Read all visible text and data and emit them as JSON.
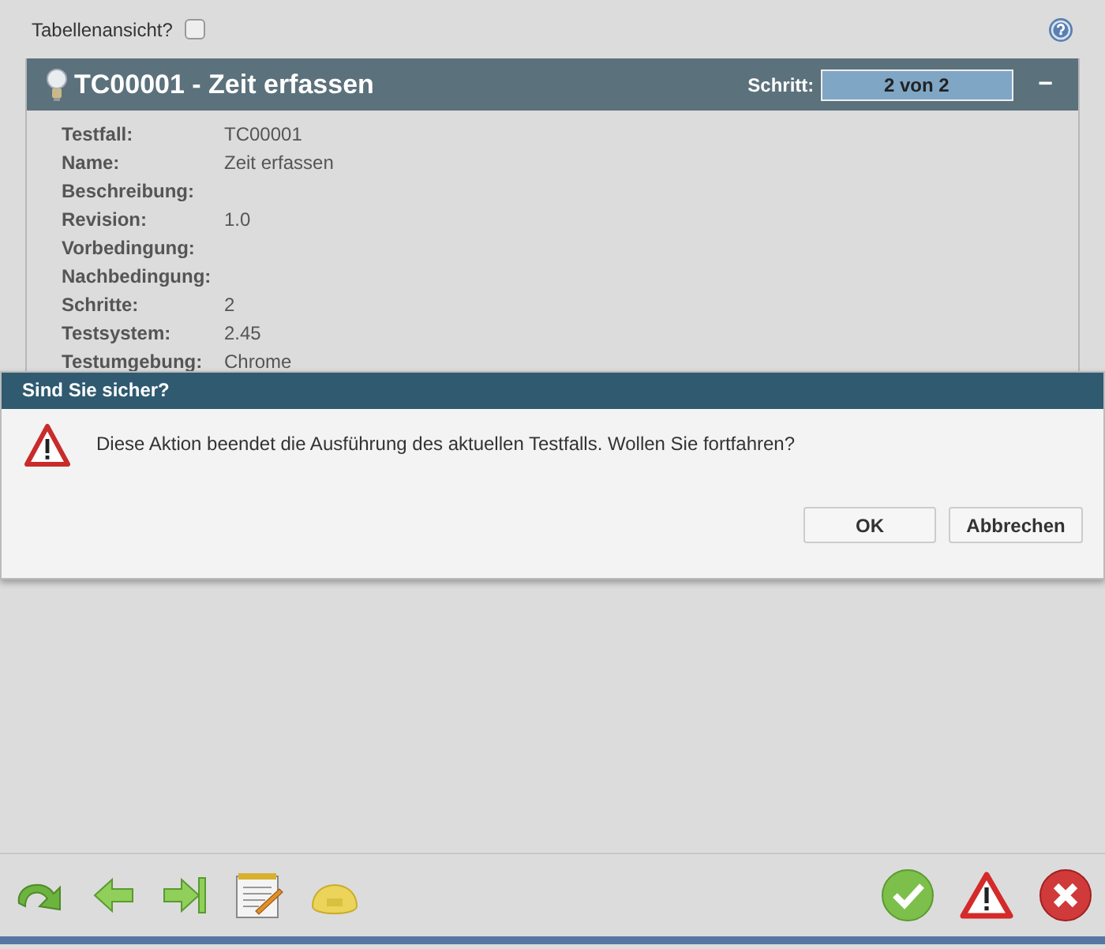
{
  "top_bar": {
    "table_view": {
      "label": "Tabellenansicht?",
      "checked": false
    }
  },
  "panel": {
    "title": "TC00001 - Zeit erfassen",
    "step_label": "Schritt:",
    "step_value": "2 von 2",
    "collapse": "−",
    "fields": [
      {
        "label": "Testfall:",
        "value": "TC00001"
      },
      {
        "label": "Name:",
        "value": "Zeit erfassen"
      },
      {
        "label": "Beschreibung:"
      },
      {
        "label": "Revision:",
        "value": "1.0"
      },
      {
        "label": "Vorbedingung:"
      },
      {
        "label": "Nachbedingung:"
      },
      {
        "label": "Schritte:",
        "value": "2"
      },
      {
        "label": "Testsystem:",
        "value": "2.45"
      },
      {
        "label": "Testumgebung:",
        "value": "Chrome"
      }
    ]
  },
  "dialog": {
    "title": "Sind Sie sicher?",
    "message": "Diese Aktion beendet die Ausführung des aktuellen Testfalls. Wollen Sie fortfahren?",
    "buttons": [
      "OK",
      "Abbrechen"
    ]
  },
  "toolbar": {
    "left": [
      {
        "kind": "redo"
      },
      {
        "kind": "back"
      },
      {
        "kind": "skip"
      },
      {
        "kind": "notes"
      },
      {
        "kind": "helmet"
      }
    ],
    "right": [
      {
        "kind": "pass"
      },
      {
        "kind": "warn"
      },
      {
        "kind": "fail"
      }
    ]
  }
}
